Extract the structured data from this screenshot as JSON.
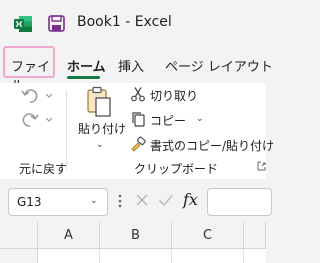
{
  "titlebar": {
    "app_icon": "excel-logo",
    "save_icon": "save-icon",
    "title": "Book1  -  Excel"
  },
  "menu": {
    "file": "ファイル",
    "home": "ホーム",
    "insert": "挿入",
    "page_layout": "ページ レイアウト"
  },
  "ribbon": {
    "undo_group_label": "元に戻す",
    "paste_label": "貼り付け",
    "cut_label": "切り取り",
    "copy_label": "コピー",
    "format_painter_label": "書式のコピー/貼り付け",
    "clipboard_group_label": "クリップボード"
  },
  "formula_bar": {
    "name_box_value": "G13",
    "fx_label": "fx",
    "formula_value": ""
  },
  "grid": {
    "columns": [
      "A",
      "B",
      "C",
      ""
    ]
  },
  "colors": {
    "excel_green": "#107c41",
    "file_tab_outline": "#f0a8d0",
    "ribbon_bg": "#ffffff",
    "chrome_bg": "#f3f3f3"
  }
}
